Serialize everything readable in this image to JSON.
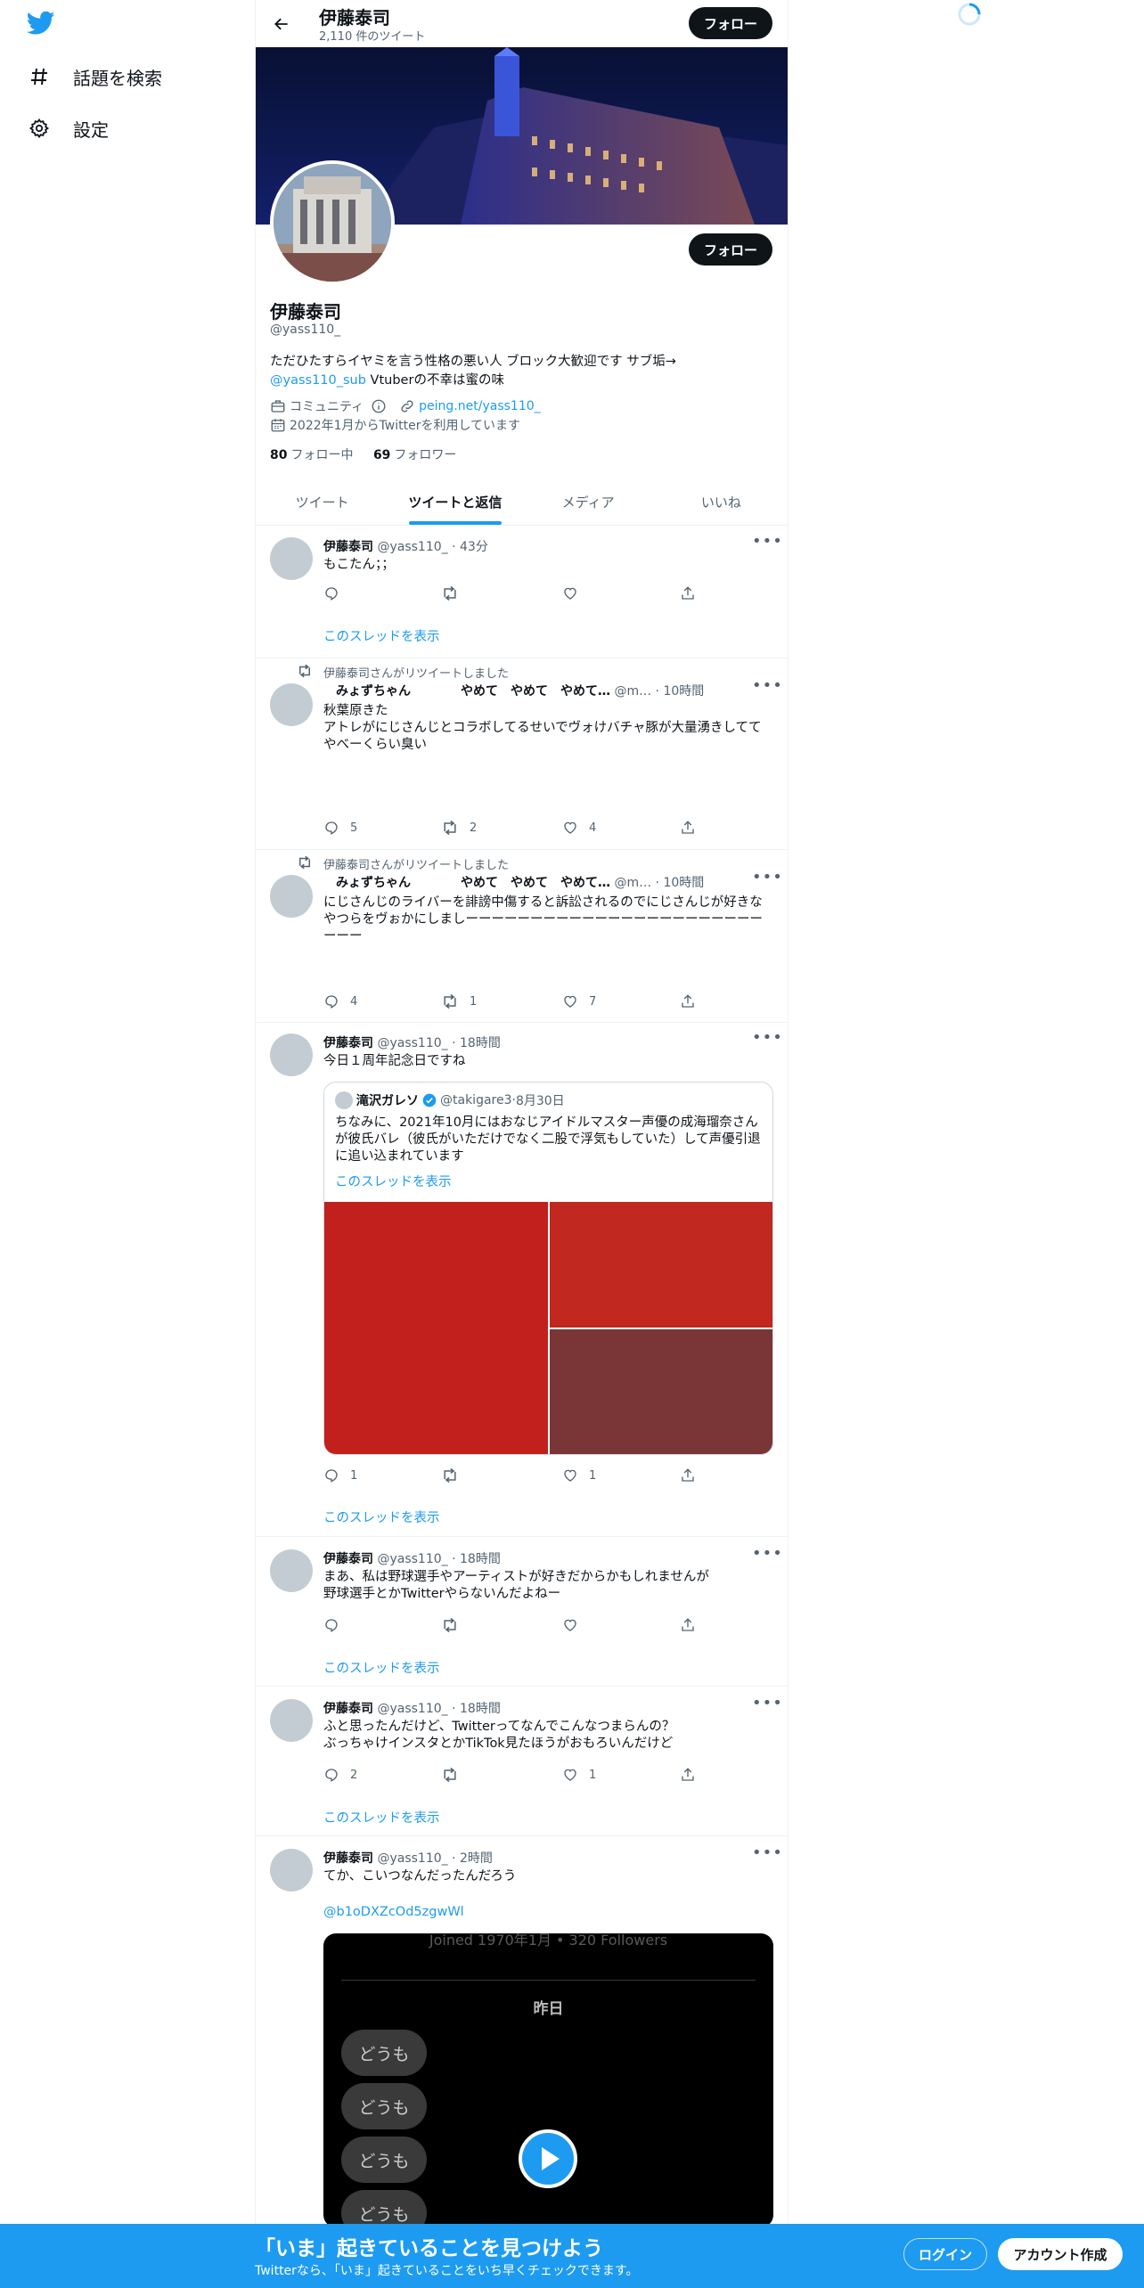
{
  "nav": {
    "explore_label": "話題を検索",
    "settings_label": "設定"
  },
  "topbar": {
    "name": "伊藤泰司",
    "tweet_count": "2,110 件のツイート",
    "follow_label": "フォロー"
  },
  "profile": {
    "name": "伊藤泰司",
    "handle": "@yass110_",
    "follow_label": "フォロー",
    "bio_line1": "ただひたすらイヤミを言う性格の悪い人 ブロック大歓迎です サブ垢→",
    "bio_link": "@yass110_sub",
    "bio_line2": " Vtuberの不幸は蜜の味",
    "category": "コミュニティ",
    "website": "peing.net/yass110_",
    "joined": "2022年1月からTwitterを利用しています",
    "following_count": "80",
    "following_label": "フォロー中",
    "followers_count": "69",
    "followers_label": "フォロワー"
  },
  "tabs": [
    {
      "label": "ツイート",
      "active": false
    },
    {
      "label": "ツイートと返信",
      "active": true
    },
    {
      "label": "メディア",
      "active": false
    },
    {
      "label": "いいね",
      "active": false
    }
  ],
  "tweets": [
    {
      "name": "伊藤泰司",
      "handle": "@yass110_",
      "time": "43分",
      "text": "もこたん；；",
      "reply": "",
      "retweet": "",
      "like": "",
      "thread": "このスレッドを表示"
    },
    {
      "retweeted_by": "伊藤泰司さんがリツイートしました",
      "name": "　みょずちゃん　　　　やめて　やめて　やめて…",
      "handle": "@m…",
      "time": "10時間",
      "text": "秋葉原きた\nアトレがにじさんじとコラボしてるせいでヴォけバチャ豚が大量湧きしててやべーくらい臭い",
      "reply": "5",
      "retweet": "2",
      "like": "4"
    },
    {
      "retweeted_by": "伊藤泰司さんがリツイートしました",
      "name": "　みょずちゃん　　　　やめて　やめて　やめて…",
      "handle": "@m…",
      "time": "10時間",
      "text": "にじさんじのライバーを誹謗中傷すると訴訟されるのでにじさんじが好きなやつらをヴぉかにしましーーーーーーーーーーーーーーーーーーーーーーーーーー",
      "reply": "4",
      "retweet": "1",
      "like": "7"
    },
    {
      "name": "伊藤泰司",
      "handle": "@yass110_",
      "time": "18時間",
      "text": "今日１周年記念日ですね",
      "quote": {
        "name": "滝沢ガレソ",
        "handle": "@takigare3",
        "time": "8月30日",
        "text": "ちなみに、2021年10月にはおなじアイドルマスター声優の成海瑠奈さんが彼氏バレ（彼氏がいただけでなく二股で浮気もしていた）して声優引退に追い込まれています",
        "thread": "このスレッドを表示"
      },
      "reply": "1",
      "retweet": "",
      "like": "1",
      "thread": "このスレッドを表示"
    },
    {
      "name": "伊藤泰司",
      "handle": "@yass110_",
      "time": "18時間",
      "text": "まあ、私は野球選手やアーティストが好きだからかもしれませんが\n野球選手とかTwitterやらないんだよねー",
      "reply": "",
      "retweet": "",
      "like": "",
      "thread": "このスレッドを表示"
    },
    {
      "name": "伊藤泰司",
      "handle": "@yass110_",
      "time": "18時間",
      "text": "ふと思ったんだけど、Twitterってなんでこんなつまらんの？\nぶっちゃけインスタとかTikTok見たほうがおもろいんだけど",
      "reply": "2",
      "retweet": "",
      "like": "1",
      "thread": "このスレッドを表示"
    },
    {
      "name": "伊藤泰司",
      "handle": "@yass110_",
      "time": "2時間",
      "text": "てか、こいつなんだったんだろう",
      "link": "@b1oDXZcOd5zgwWl",
      "video": {
        "top_text": "Joined 1970年1月 • 320 Followers",
        "day_label": "昨日",
        "chips": [
          "どうも",
          "どうも",
          "どうも",
          "どうも"
        ]
      }
    }
  ],
  "bottom": {
    "title": "「いま」起きていることを見つけよう",
    "subtitle": "Twitterなら、「いま」起きていることをいち早くチェックできます。",
    "login": "ログイン",
    "signup": "アカウント作成"
  },
  "colors": {
    "accent": "#1d9bf0",
    "media_red_1": "#c1201c",
    "media_red_2": "#c1281f",
    "media_red_3": "#7a3536"
  }
}
